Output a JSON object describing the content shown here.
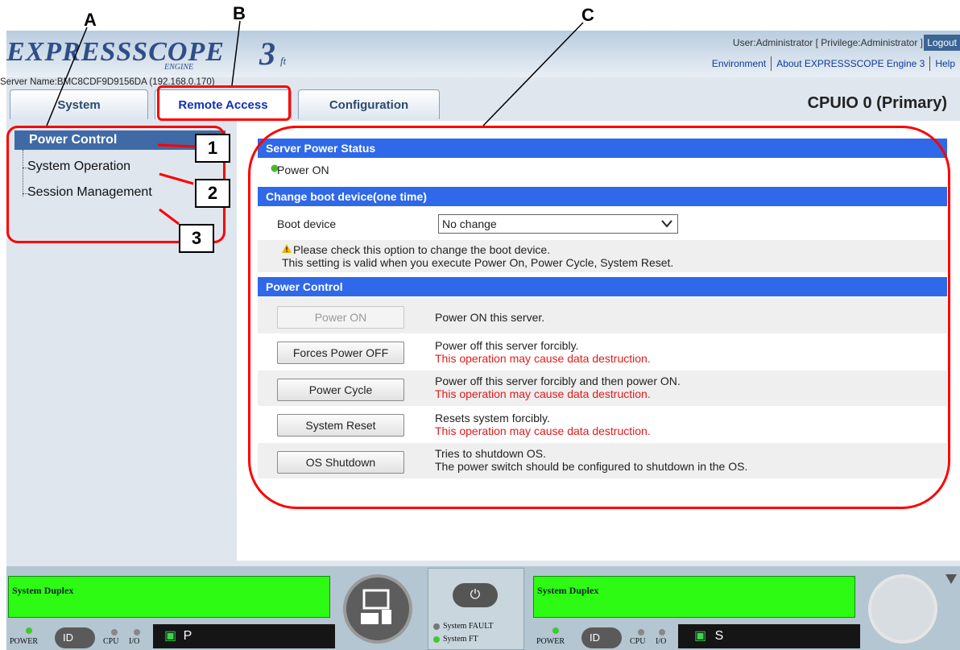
{
  "callouts": {
    "a": "A",
    "b": "B",
    "c": "C"
  },
  "badges": [
    "1",
    "2",
    "3"
  ],
  "header": {
    "logo_main": "EXPRESSSCOPE",
    "logo_sub": "ENGINE",
    "logo_num": "3",
    "logo_ft": "ft",
    "user_info": "User:Administrator [ Privilege:Administrator ]",
    "logout": "Logout",
    "links": [
      "Environment",
      "About EXPRESSSCOPE Engine 3",
      "Help"
    ],
    "server_name": "Server Name:BMC8CDF9D9156DA (192.168.0.170)"
  },
  "tabs": [
    "System",
    "Remote Access",
    "Configuration"
  ],
  "page_title": "CPUIO 0 (Primary)",
  "sidebar": {
    "items": [
      "Power Control",
      "System Operation",
      "Session Management"
    ]
  },
  "sections": {
    "status": {
      "title": "Server Power Status",
      "value": "Power ON",
      "indicator_color": "#49b82a"
    },
    "boot": {
      "title": "Change boot device(one time)",
      "label": "Boot device",
      "selected": "No change",
      "note_line1": "Please check this option to change the boot device.",
      "note_line2": "This setting is valid when you execute Power On, Power Cycle, System Reset."
    },
    "power": {
      "title": "Power Control",
      "rows": [
        {
          "button": "Power ON",
          "desc": "Power ON this server.",
          "warn": "",
          "disabled": true
        },
        {
          "button": "Forces Power OFF",
          "desc": "Power off this server forcibly.",
          "warn": "This operation may cause data destruction.",
          "disabled": false
        },
        {
          "button": "Power Cycle",
          "desc": "Power off this server forcibly and then power ON.",
          "warn": "This operation may cause data destruction.",
          "disabled": false
        },
        {
          "button": "System Reset",
          "desc": "Resets system forcibly.",
          "warn": "This operation may cause data destruction.",
          "disabled": false
        },
        {
          "button": "OS Shutdown",
          "desc": "Tries to shutdown OS.",
          "warn": "The power switch should be configured to shutdown in the OS.",
          "disabled": false
        }
      ]
    }
  },
  "bottom": {
    "left_duplex": "System Duplex",
    "right_duplex": "System Duplex",
    "power_label": "POWER",
    "id_label": "ID",
    "cpu_label": "CPU",
    "io_label": "I/O",
    "left_lcd": "P",
    "right_lcd": "S",
    "fault_label": "System FAULT",
    "ft_label": "System FT"
  },
  "colors": {
    "accent": "#2f68e8",
    "nav_active": "#3f6aa6",
    "warning": "#e01b1b",
    "duplex_green": "#2dfb14",
    "annotation_red": "#ff0000"
  }
}
